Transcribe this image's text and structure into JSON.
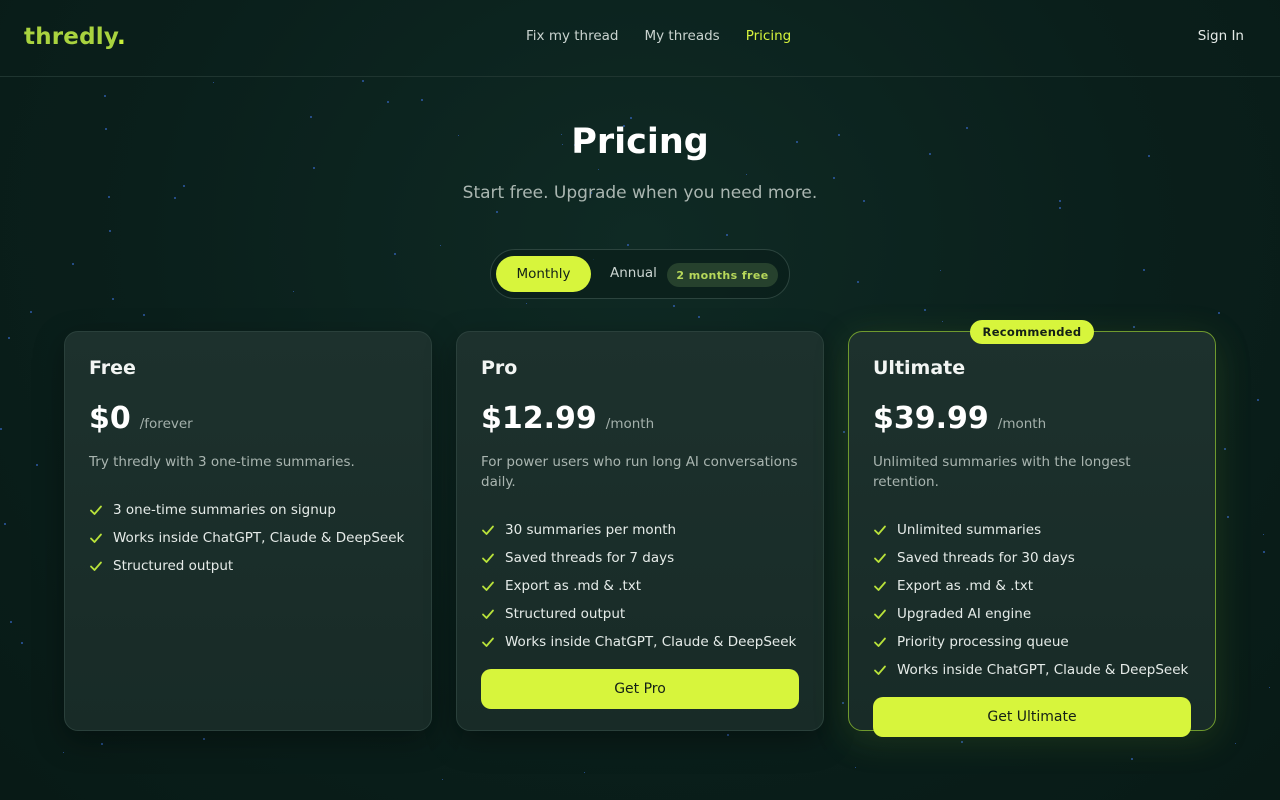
{
  "header": {
    "logo": "thredly",
    "logo_dot": ".",
    "nav": [
      {
        "label": "Fix my thread"
      },
      {
        "label": "My threads"
      },
      {
        "label": "Pricing",
        "active": true
      }
    ],
    "sign_in": "Sign In"
  },
  "hero": {
    "title": "Pricing",
    "subtitle": "Start free. Upgrade when you need more."
  },
  "billing_toggle": {
    "monthly": "Monthly",
    "annual": "Annual",
    "annual_badge": "2 months free",
    "selected": "Monthly"
  },
  "plans": [
    {
      "name": "Free",
      "price": "$0",
      "period": "/forever",
      "description": "Try thredly with 3 one-time summaries.",
      "features": [
        "3 one-time summaries on signup",
        "Works inside ChatGPT, Claude & DeepSeek",
        "Structured output"
      ]
    },
    {
      "name": "Pro",
      "price": "$12.99",
      "period": "/month",
      "description": "For power users who run long AI conversations daily.",
      "features": [
        "30 summaries per month",
        "Saved threads for 7 days",
        "Export as .md & .txt",
        "Structured output",
        "Works inside ChatGPT, Claude & DeepSeek"
      ],
      "cta": "Get Pro"
    },
    {
      "name": "Ultimate",
      "badge": "Recommended",
      "price": "$39.99",
      "period": "/month",
      "description": "Unlimited summaries with the longest retention.",
      "features": [
        "Unlimited summaries",
        "Saved threads for 30 days",
        "Export as .md & .txt",
        "Upgraded AI engine",
        "Priority processing queue",
        "Works inside ChatGPT, Claude & DeepSeek"
      ],
      "cta": "Get Ultimate"
    }
  ],
  "colors": {
    "accent": "#d7f53c",
    "background": "#0a1f1b",
    "card": "#1b2f2b",
    "check": "#b9e23a"
  },
  "icons": {
    "feature_check": "check-icon"
  }
}
